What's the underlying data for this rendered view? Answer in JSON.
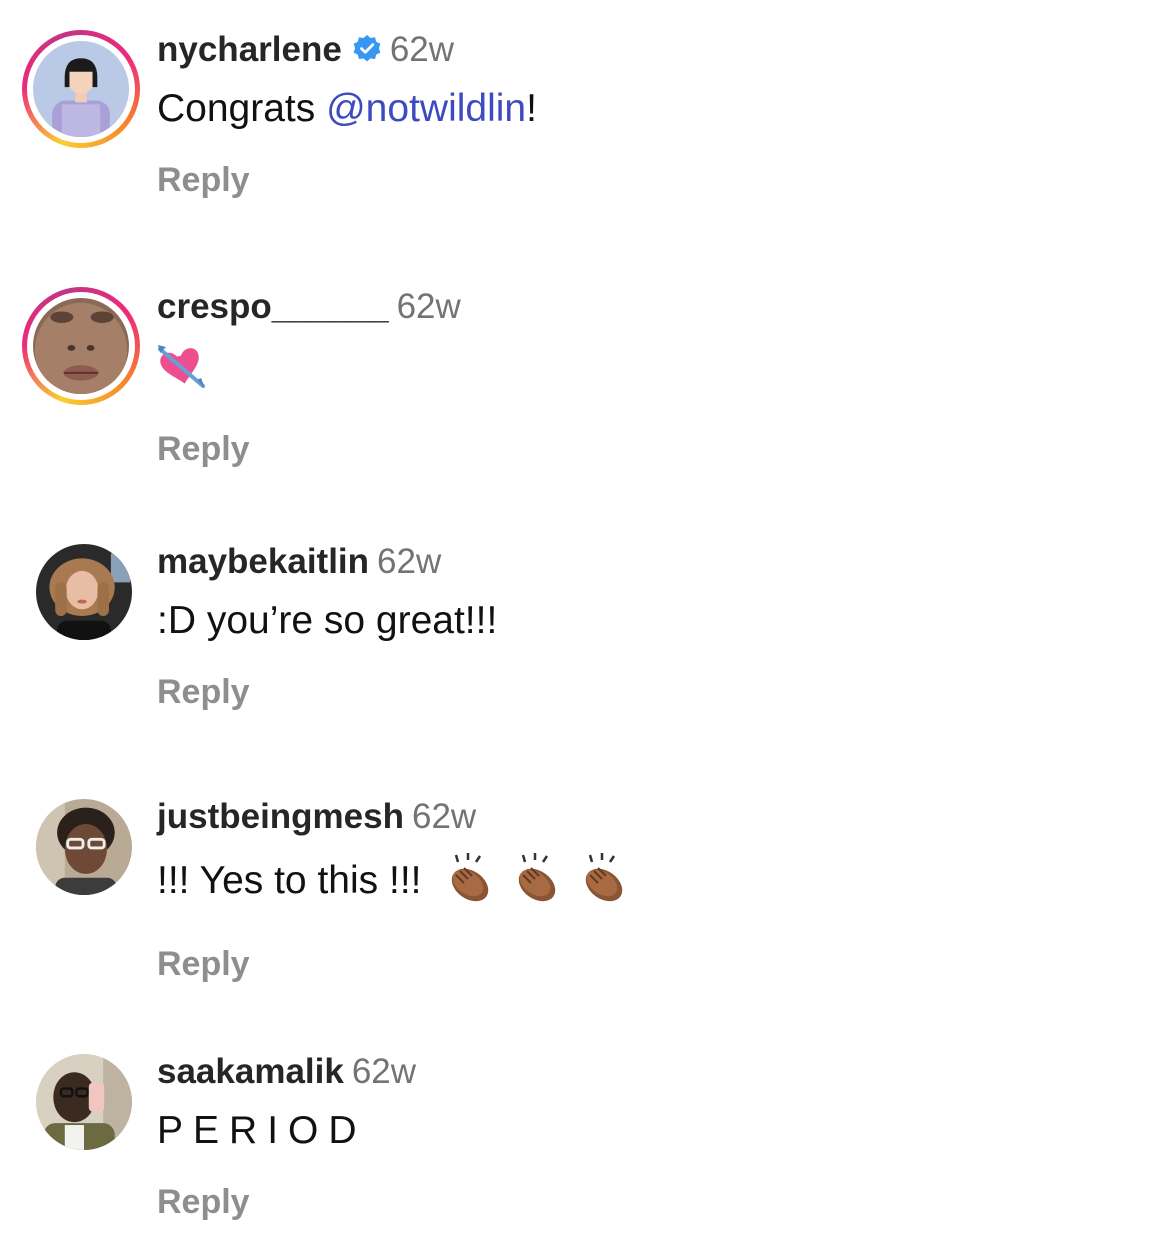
{
  "comments": [
    {
      "username": "nycharlene",
      "verified": true,
      "time": "62w",
      "text_before": "Congrats ",
      "mention": "@notwildlin",
      "text_after": "!",
      "reply_label": "Reply",
      "has_story_ring": true
    },
    {
      "username": "crespo______",
      "verified": false,
      "time": "62w",
      "emoji": "heart-with-arrow",
      "reply_label": "Reply",
      "has_story_ring": true
    },
    {
      "username": "maybekaitlin",
      "verified": false,
      "time": "62w",
      "text": ":D you’re so great!!!",
      "reply_label": "Reply",
      "has_story_ring": false
    },
    {
      "username": "justbeingmesh",
      "verified": false,
      "time": "62w",
      "text": "!!! Yes to this !!!",
      "emoji": "clapping-hands x3",
      "reply_label": "Reply",
      "has_story_ring": false
    },
    {
      "username": "saakamalik",
      "verified": false,
      "time": "62w",
      "text": "PERIOD",
      "reply_label": "Reply",
      "has_story_ring": false
    }
  ],
  "colors": {
    "username": "#262626",
    "timestamp": "#737373",
    "reply": "#8e8e8e",
    "mention": "#3c4bbf",
    "verified_badge": "#3897f0"
  }
}
